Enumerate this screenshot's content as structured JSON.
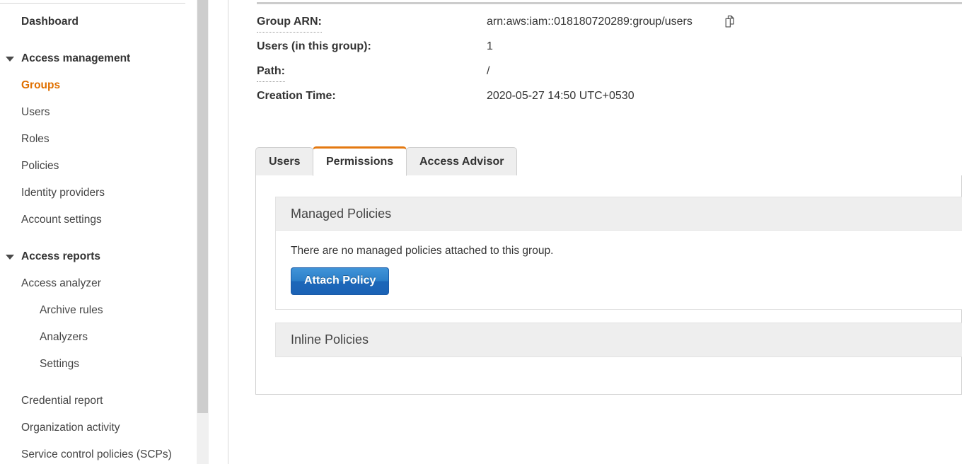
{
  "sidebar": {
    "items": [
      {
        "label": "Dashboard",
        "level": "group",
        "caret": false,
        "active": false,
        "gap_after": true
      },
      {
        "label": "Access management",
        "level": "group",
        "caret": true,
        "active": false,
        "gap_after": false
      },
      {
        "label": "Groups",
        "level": "1",
        "caret": false,
        "active": true,
        "gap_after": false
      },
      {
        "label": "Users",
        "level": "1",
        "caret": false,
        "active": false,
        "gap_after": false
      },
      {
        "label": "Roles",
        "level": "1",
        "caret": false,
        "active": false,
        "gap_after": false
      },
      {
        "label": "Policies",
        "level": "1",
        "caret": false,
        "active": false,
        "gap_after": false
      },
      {
        "label": "Identity providers",
        "level": "1",
        "caret": false,
        "active": false,
        "gap_after": false
      },
      {
        "label": "Account settings",
        "level": "1",
        "caret": false,
        "active": false,
        "gap_after": true
      },
      {
        "label": "Access reports",
        "level": "group",
        "caret": true,
        "active": false,
        "gap_after": false
      },
      {
        "label": "Access analyzer",
        "level": "1",
        "caret": false,
        "active": false,
        "gap_after": false
      },
      {
        "label": "Archive rules",
        "level": "2",
        "caret": false,
        "active": false,
        "gap_after": false
      },
      {
        "label": "Analyzers",
        "level": "2",
        "caret": false,
        "active": false,
        "gap_after": false
      },
      {
        "label": "Settings",
        "level": "2",
        "caret": false,
        "active": false,
        "gap_after": true
      },
      {
        "label": "Credential report",
        "level": "1",
        "caret": false,
        "active": false,
        "gap_after": false
      },
      {
        "label": "Organization activity",
        "level": "1",
        "caret": false,
        "active": false,
        "gap_after": false
      },
      {
        "label": "Service control policies (SCPs)",
        "level": "1",
        "caret": false,
        "active": false,
        "gap_after": false
      }
    ]
  },
  "details": {
    "rows": [
      {
        "label": "Group ARN:",
        "value": "arn:aws:iam::018180720289:group/users",
        "dotted": true,
        "copy": true
      },
      {
        "label": "Users (in this group):",
        "value": "1",
        "dotted": false,
        "copy": false
      },
      {
        "label": "Path:",
        "value": "/",
        "dotted": true,
        "copy": false
      },
      {
        "label": "Creation Time:",
        "value": "2020-05-27 14:50 UTC+0530",
        "dotted": false,
        "copy": false
      }
    ]
  },
  "tabs": {
    "items": [
      {
        "label": "Users",
        "active": false
      },
      {
        "label": "Permissions",
        "active": true
      },
      {
        "label": "Access Advisor",
        "active": false
      }
    ]
  },
  "permissions": {
    "managed": {
      "title": "Managed Policies",
      "empty_message": "There are no managed policies attached to this group.",
      "attach_button": "Attach Policy"
    },
    "inline": {
      "title": "Inline Policies"
    }
  },
  "colors": {
    "accent_orange": "#e47911",
    "active_nav_orange": "#e07000",
    "primary_button_blue": "#2c7fc9",
    "panel_header_grey": "#eeeeee",
    "border_grey": "#cfcfcf"
  },
  "icons": {
    "copy_arn": "copy-icon"
  }
}
